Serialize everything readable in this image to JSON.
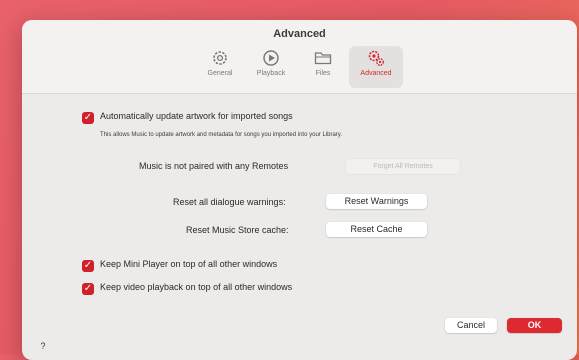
{
  "window": {
    "title": "Advanced"
  },
  "tabs": [
    {
      "label": "General",
      "icon": "gear-icon"
    },
    {
      "label": "Playback",
      "icon": "play-circle-icon"
    },
    {
      "label": "Files",
      "icon": "folder-icon"
    },
    {
      "label": "Advanced",
      "icon": "gears-icon",
      "active": true
    }
  ],
  "settings": {
    "artwork": {
      "label": "Automatically update artwork for imported songs",
      "description": "This allows Music to update artwork and metadata for songs you imported into your Library.",
      "checked": true
    },
    "remotes": {
      "label": "Music is not paired with any Remotes",
      "button": "Forget All Remotes"
    },
    "reset_warnings": {
      "label": "Reset all dialogue warnings:",
      "button": "Reset Warnings"
    },
    "reset_cache": {
      "label": "Reset Music Store cache:",
      "button": "Reset Cache"
    },
    "mini_player": {
      "label": "Keep Mini Player on top of all other windows",
      "checked": true
    },
    "video_playback": {
      "label": "Keep video playback on top of all other windows",
      "checked": true
    }
  },
  "footer": {
    "help": "?",
    "cancel": "Cancel",
    "ok": "OK"
  },
  "colors": {
    "accent": "#d0212b",
    "ok_button": "#dd2a31"
  }
}
